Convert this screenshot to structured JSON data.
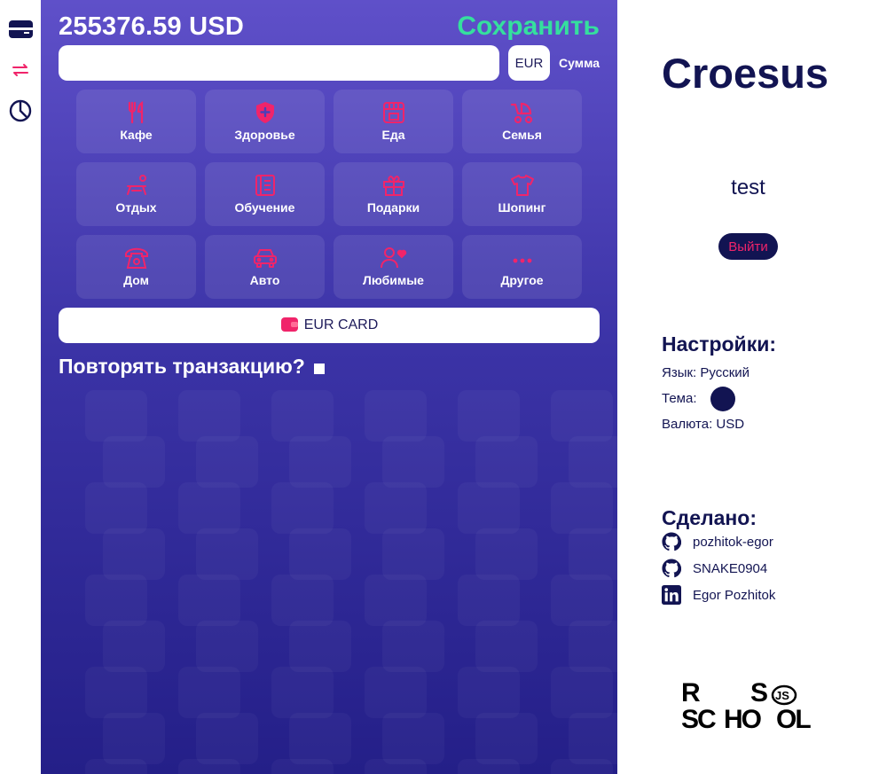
{
  "nav": {
    "items": [
      {
        "name": "cards",
        "icon": "card-icon",
        "color": "#121452"
      },
      {
        "name": "transactions",
        "icon": "exchange-arrows-icon",
        "color": "#f0246a",
        "active": true
      },
      {
        "name": "statistics",
        "icon": "pie-chart-icon",
        "color": "#121452"
      }
    ]
  },
  "header": {
    "balance": "255376.59 USD",
    "save_label": "Сохранить"
  },
  "amount": {
    "value": "",
    "placeholder": "",
    "currency": "EUR",
    "label": "Сумма"
  },
  "categories": [
    {
      "label": "Кафе",
      "icon": "fork-knife-icon"
    },
    {
      "label": "Здоровье",
      "icon": "shield-cross-icon"
    },
    {
      "label": "Еда",
      "icon": "shop-icon"
    },
    {
      "label": "Семья",
      "icon": "stroller-icon"
    },
    {
      "label": "Отдых",
      "icon": "picnic-table-icon"
    },
    {
      "label": "Обучение",
      "icon": "book-icon"
    },
    {
      "label": "Подарки",
      "icon": "gift-icon"
    },
    {
      "label": "Шопинг",
      "icon": "tshirt-icon"
    },
    {
      "label": "Дом",
      "icon": "telephone-icon"
    },
    {
      "label": "Авто",
      "icon": "car-icon"
    },
    {
      "label": "Любимые",
      "icon": "person-heart-icon"
    },
    {
      "label": "Другое",
      "icon": "more-dots-icon"
    }
  ],
  "card": {
    "label": "EUR CARD",
    "icon": "wallet-icon"
  },
  "repeat": {
    "label": "Повторять транзакцию?",
    "checked": false
  },
  "sidebar": {
    "app_title": "Croesus",
    "username": "test",
    "logout_label": "Выйти",
    "settings_title": "Настройки:",
    "language": "Язык: Русский",
    "theme_label": "Тема:",
    "currency": "Валюта: USD",
    "credits_title": "Сделано:",
    "credits": [
      {
        "label": "pozhitok-egor",
        "icon": "github-icon"
      },
      {
        "label": "SNAKE0904",
        "icon": "github-icon"
      },
      {
        "label": "Egor Pozhitok",
        "icon": "linkedin-icon"
      }
    ],
    "school_logo": "RS SCHOOL JS"
  },
  "colors": {
    "accent": "#f0246a",
    "save": "#35df9e",
    "navy": "#121452",
    "gradient_top": "#5f50c9",
    "gradient_bottom": "#241f88"
  }
}
